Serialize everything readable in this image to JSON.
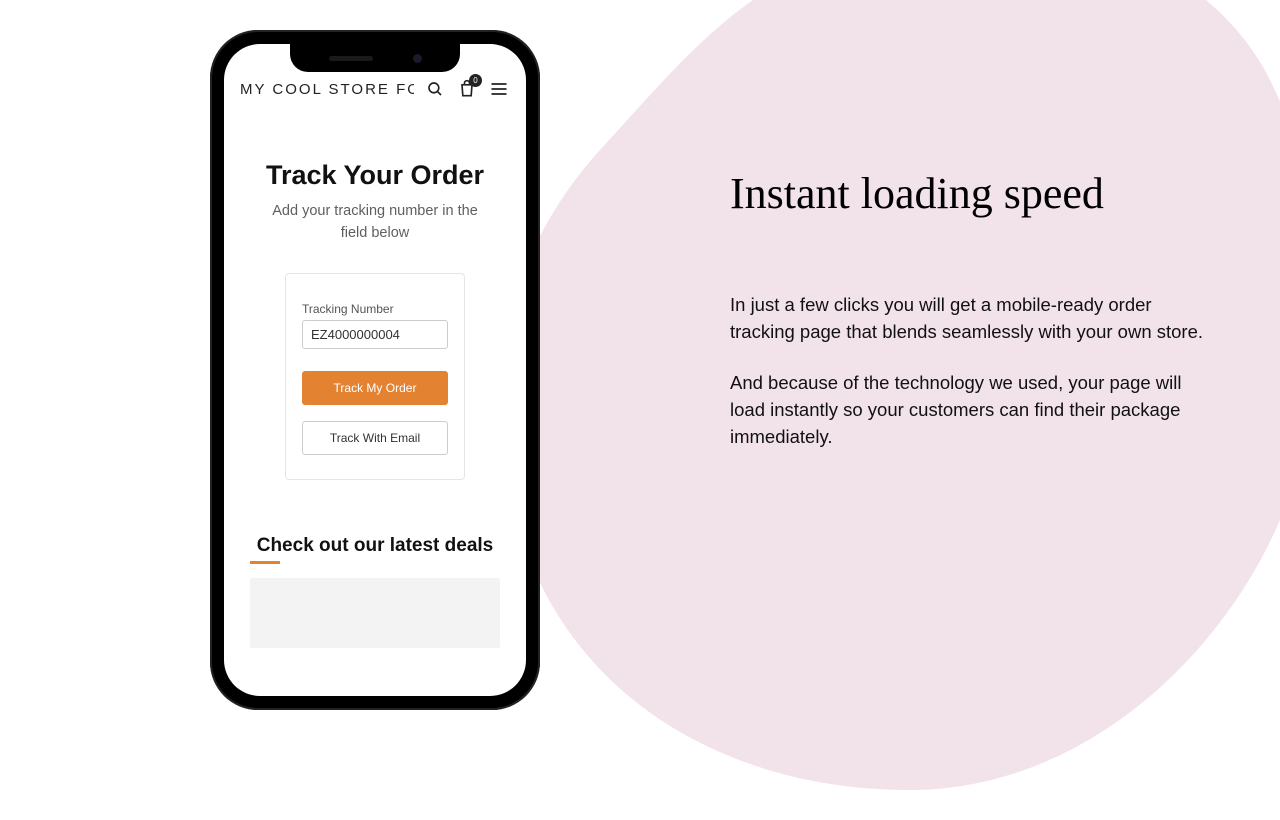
{
  "phone": {
    "store_name": "MY COOL STORE FOR",
    "cart_badge": "0",
    "track_title": "Track Your Order",
    "track_sub": "Add your tracking number in the field below",
    "tracking_label": "Tracking Number",
    "tracking_value": "EZ4000000004",
    "track_button": "Track My Order",
    "email_button": "Track With Email",
    "deals_title": "Check out our latest deals"
  },
  "marketing": {
    "headline": "Instant loading speed",
    "para1": "In just a few clicks you will get a mobile-ready order tracking page that blends seamlessly with your own store.",
    "para2": "And because of the technology we used, your  page will load instantly so your customers can find their package immediately."
  },
  "colors": {
    "accent": "#e38332",
    "blob": "#f2e2ea"
  }
}
